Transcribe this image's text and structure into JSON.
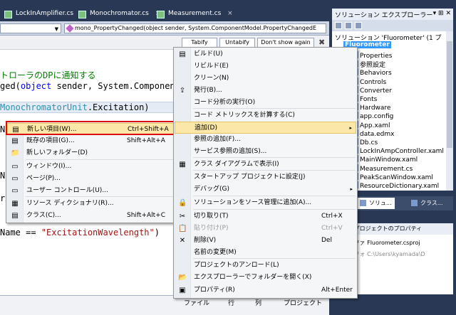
{
  "editor": {
    "doc_tabs": [
      {
        "label": "LockInAmplifier.cs",
        "close": "×"
      },
      {
        "label": "Monochromator.cs",
        "close": "×"
      },
      {
        "label": "Measurement.cs",
        "close": "×"
      }
    ],
    "member_dropdown": "mono_PropertyChanged(object sender, System.ComponentModel.PropertyChangedE",
    "infobar": {
      "tabify": "Tabify",
      "untabify": "Untabify",
      "dont_show": "Don't show again",
      "close": "✖"
    },
    "code": {
      "line1_comment": "トローラのDPに通知する",
      "line2_pre": "ged(",
      "line2_kw": "object",
      "line2_post": " sender, System.ComponentM",
      "line3_type": "MonochromatorUnit",
      "line3_post": ".Excitation)",
      "line4": "N",
      "line5": "N",
      "line6": "r",
      "line7_pre": "Name == ",
      "line7_str": "\"ExcitationWavelength\"",
      "line7_post": ")"
    },
    "grid_headers": {
      "file": "ファイル",
      "line": "行",
      "col": "列",
      "project": "プロジェクト"
    }
  },
  "solution_explorer": {
    "title": "ソリューション エクスプローラー",
    "title_icons": "▾ ⊞ ✕",
    "root": "ソリューション 'Fluorometer' (1 プ",
    "project": "Fluorometer",
    "items": [
      "Properties",
      "参照設定",
      "Behaviors",
      "Controls",
      "Converter",
      "Fonts",
      "Hardware",
      "app.config",
      "App.xaml",
      "data.edmx",
      "Db.cs",
      "LockInAmpController.xaml",
      "MainWindow.xaml",
      "Measurement.cs",
      "PeakScanWindow.xaml",
      "ResourceDictionary.xaml"
    ],
    "tabs": [
      "ソリュ...",
      "クラス..."
    ],
    "properties_title": "meter プロジェクトのプロパティ",
    "prop_rows": [
      {
        "name": "ェクト ファ",
        "value": "Fluorometer.csproj"
      },
      {
        "name": "ェクト フォ",
        "value": "C:\\Users\\kyamada\\D"
      }
    ]
  },
  "context_menu": {
    "items": [
      {
        "label": "ビルド(U)",
        "icon": "build-icon"
      },
      {
        "label": "リビルド(E)"
      },
      {
        "label": "クリーン(N)"
      },
      {
        "label": "発行(B)...",
        "icon": "publish-icon"
      },
      {
        "label": "コード分析の実行(O)"
      },
      {
        "label": "コード メトリックスを計算する(C)"
      },
      {
        "label": "追加(D)",
        "submenu": "▸"
      },
      {
        "label": "参照の追加(F)..."
      },
      {
        "label": "サービス参照の追加(S)..."
      },
      {
        "label": "クラス ダイアグラムで表示(I)",
        "icon": "class-diagram-icon"
      },
      {
        "label": "スタートアップ プロジェクトに設定(J)"
      },
      {
        "label": "デバッグ(G)",
        "submenu": "▸"
      },
      {
        "label": "ソリューションをソース管理に追加(A)...",
        "icon": "source-control-icon"
      },
      {
        "label": "切り取り(T)",
        "shortcut": "Ctrl+X",
        "icon": "scissors-icon"
      },
      {
        "label": "貼り付け(P)",
        "shortcut": "Ctrl+V",
        "icon": "paste-icon"
      },
      {
        "label": "削除(V)",
        "shortcut": "Del",
        "icon": "delete-icon"
      },
      {
        "label": "名前の変更(M)"
      },
      {
        "label": "プロジェクトのアンロード(L)"
      },
      {
        "label": "エクスプローラーでフォルダーを開く(X)",
        "icon": "folder-open-icon"
      },
      {
        "label": "プロパティ(R)",
        "shortcut": "Alt+Enter",
        "icon": "properties-icon"
      }
    ]
  },
  "submenu": {
    "items": [
      {
        "label": "新しい項目(W)...",
        "shortcut": "Ctrl+Shift+A"
      },
      {
        "label": "既存の項目(G)...",
        "shortcut": "Shift+Alt+A"
      },
      {
        "label": "新しいフォルダー(D)"
      },
      {
        "label": "ウィンドウ(I)..."
      },
      {
        "label": "ページ(P)..."
      },
      {
        "label": "ユーザー コントロール(U)..."
      },
      {
        "label": "リソース ディクショナリ(R)..."
      },
      {
        "label": "クラス(C)...",
        "shortcut": "Shift+Alt+C"
      }
    ]
  },
  "colors": {
    "highlight": "#fbe8a8",
    "annotation_box": "#d90d0d",
    "chrome": "#293955"
  }
}
